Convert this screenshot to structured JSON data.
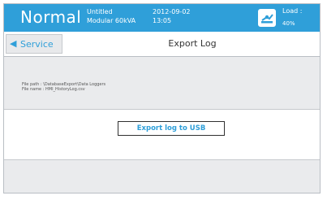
{
  "header": {
    "status": "Normal",
    "system_name": "Untitled",
    "system_model": "Modular 60kVA",
    "date": "2012-09-02",
    "time": "13:05",
    "load_label": "Load :",
    "load_value": "40%",
    "load_icon": "load-meter-icon",
    "accent_color": "#2f9fd9"
  },
  "nav": {
    "back_label": "Service",
    "back_icon": "triangle-left-icon",
    "title": "Export Log"
  },
  "file_info": {
    "path_line": "File path : \\DatabaseExport\\Data Loggers",
    "name_line": "File name : HMI_HistoryLog.csv"
  },
  "actions": {
    "export_label": "Export log to USB"
  }
}
